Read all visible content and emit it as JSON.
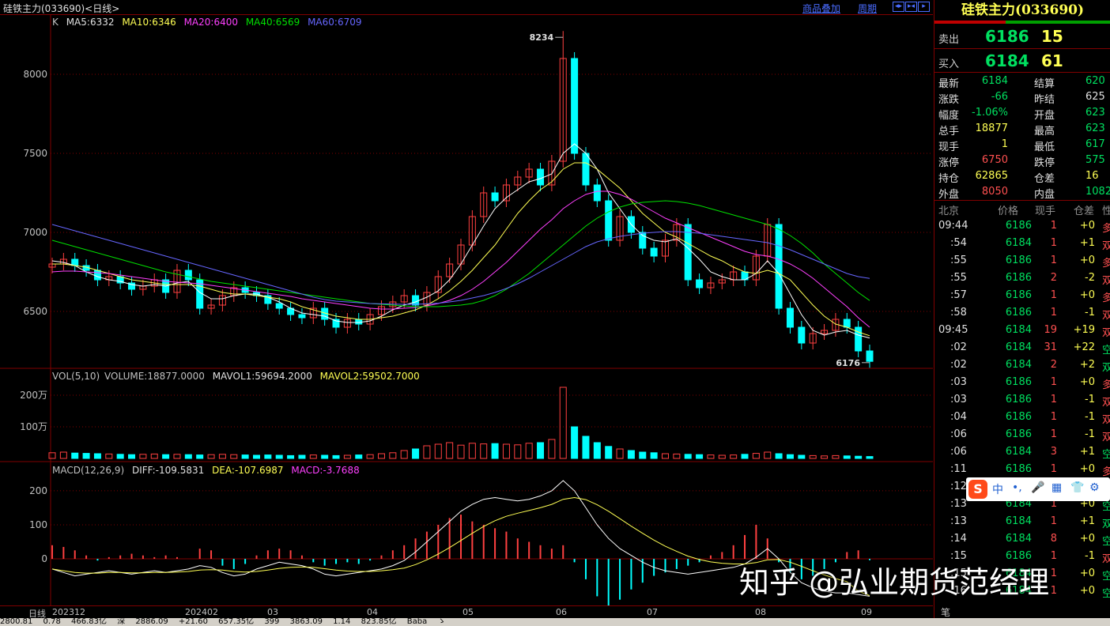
{
  "window": {
    "title": "硅铁主力(033690)<日线>",
    "links": [
      "商品叠加",
      "周期"
    ],
    "nav_buttons": [
      "◂▸",
      "▸◂",
      "▸"
    ]
  },
  "colors": {
    "up": "#ff4040",
    "down": "#00ffff",
    "ma5": "#ffffff",
    "ma10": "#ffff54",
    "ma20": "#ff40ff",
    "ma40": "#00e000",
    "ma60": "#6666ff",
    "grid": "#800000"
  },
  "price_legend": {
    "label": "K",
    "ma5": "MA5:6332",
    "ma10": "MA10:6346",
    "ma20": "MA20:6400",
    "ma40": "MA40:6569",
    "ma60": "MA60:6709"
  },
  "vol_legend": {
    "label": "VOL(5,10)",
    "volume": "VOLUME:18877.0000",
    "mavol1": "MAVOL1:59694.2000",
    "mavol2": "MAVOL2:59502.7000"
  },
  "macd_legend": {
    "label": "MACD(12,26,9)",
    "diff": "DIFF:-109.5831",
    "dea": "DEA:-107.6987",
    "macd": "MACD:-3.7688"
  },
  "chart_data": [
    {
      "type": "candlestick",
      "title": "",
      "ylim": [
        6180,
        8280
      ],
      "y_ticks": [
        "8000",
        "7500",
        "7000",
        "6500"
      ],
      "annotations": [
        {
          "label": "8234",
          "value": 8234
        },
        {
          "label": "6176",
          "value": 6176
        }
      ],
      "x_labels": [
        "202312",
        "202402",
        "03",
        "04",
        "05",
        "06",
        "07",
        "08",
        "09"
      ],
      "close_path": [
        6800,
        6830,
        6790,
        6760,
        6700,
        6720,
        6680,
        6640,
        6660,
        6700,
        6620,
        6760,
        6700,
        6520,
        6540,
        6600,
        6650,
        6620,
        6600,
        6550,
        6520,
        6480,
        6460,
        6520,
        6450,
        6400,
        6450,
        6420,
        6480,
        6530,
        6560,
        6600,
        6540,
        6620,
        6720,
        6800,
        6920,
        7100,
        7250,
        7200,
        7300,
        7350,
        7400,
        7300,
        7450,
        8100,
        7500,
        7300,
        7200,
        6950,
        7100,
        7000,
        6900,
        6850,
        6950,
        7050,
        6700,
        6650,
        6680,
        6700,
        6750,
        6700,
        6850,
        7050,
        6520,
        6400,
        6300,
        6360,
        6380,
        6450,
        6400,
        6250,
        6184
      ],
      "ma_series": [
        {
          "name": "MA5",
          "values": [
            6820,
            6810,
            6790,
            6750,
            6720,
            6700,
            6690,
            6670,
            6660,
            6670,
            6660,
            6680,
            6690,
            6620,
            6580,
            6580,
            6600,
            6610,
            6610,
            6590,
            6560,
            6520,
            6490,
            6480,
            6470,
            6440,
            6430,
            6430,
            6440,
            6470,
            6510,
            6540,
            6560,
            6590,
            6630,
            6700,
            6800,
            6920,
            7040,
            7150,
            7220,
            7270,
            7320,
            7340,
            7370,
            7500,
            7560,
            7500,
            7400,
            7250,
            7150,
            7050,
            6980,
            6950,
            6940,
            6960,
            6900,
            6830,
            6750,
            6720,
            6700,
            6700,
            6740,
            6820,
            6740,
            6610,
            6480,
            6380,
            6350,
            6370,
            6380,
            6350,
            6332
          ]
        },
        {
          "name": "MA10",
          "values": [
            6800,
            6800,
            6790,
            6780,
            6760,
            6740,
            6720,
            6700,
            6690,
            6680,
            6670,
            6670,
            6670,
            6660,
            6640,
            6620,
            6610,
            6610,
            6600,
            6590,
            6580,
            6560,
            6530,
            6510,
            6490,
            6470,
            6460,
            6450,
            6450,
            6460,
            6470,
            6490,
            6510,
            6540,
            6580,
            6630,
            6690,
            6760,
            6840,
            6920,
            7020,
            7120,
            7200,
            7270,
            7320,
            7400,
            7440,
            7440,
            7400,
            7340,
            7280,
            7200,
            7120,
            7060,
            7000,
            6970,
            6930,
            6890,
            6850,
            6820,
            6780,
            6750,
            6740,
            6760,
            6740,
            6700,
            6620,
            6540,
            6470,
            6420,
            6400,
            6370,
            6346
          ]
        },
        {
          "name": "MA20",
          "values": [
            6750,
            6755,
            6755,
            6750,
            6745,
            6740,
            6730,
            6720,
            6710,
            6700,
            6690,
            6685,
            6680,
            6675,
            6665,
            6655,
            6645,
            6635,
            6625,
            6615,
            6605,
            6595,
            6580,
            6570,
            6560,
            6550,
            6540,
            6530,
            6520,
            6515,
            6515,
            6520,
            6525,
            6535,
            6550,
            6570,
            6600,
            6640,
            6690,
            6750,
            6810,
            6880,
            6950,
            7020,
            7080,
            7150,
            7200,
            7240,
            7260,
            7260,
            7240,
            7210,
            7170,
            7130,
            7090,
            7060,
            7030,
            7000,
            6970,
            6940,
            6910,
            6880,
            6860,
            6850,
            6830,
            6800,
            6760,
            6710,
            6650,
            6590,
            6530,
            6460,
            6400
          ]
        },
        {
          "name": "MA40",
          "values": [
            6950,
            6930,
            6910,
            6890,
            6870,
            6850,
            6830,
            6810,
            6790,
            6770,
            6750,
            6735,
            6720,
            6705,
            6690,
            6680,
            6670,
            6660,
            6650,
            6640,
            6630,
            6620,
            6610,
            6600,
            6590,
            6580,
            6570,
            6560,
            6550,
            6545,
            6540,
            6535,
            6530,
            6530,
            6530,
            6535,
            6540,
            6550,
            6570,
            6600,
            6640,
            6690,
            6740,
            6800,
            6860,
            6920,
            6980,
            7040,
            7090,
            7130,
            7160,
            7180,
            7190,
            7195,
            7200,
            7195,
            7185,
            7170,
            7150,
            7130,
            7110,
            7090,
            7070,
            7050,
            7020,
            6980,
            6930,
            6870,
            6800,
            6740,
            6680,
            6620,
            6569
          ]
        },
        {
          "name": "MA60",
          "values": [
            7050,
            7030,
            7010,
            6990,
            6970,
            6950,
            6930,
            6910,
            6890,
            6870,
            6850,
            6830,
            6810,
            6790,
            6770,
            6750,
            6730,
            6710,
            6690,
            6670,
            6650,
            6630,
            6610,
            6590,
            6575,
            6565,
            6560,
            6555,
            6550,
            6548,
            6546,
            6545,
            6545,
            6548,
            6552,
            6560,
            6570,
            6585,
            6600,
            6620,
            6645,
            6675,
            6710,
            6750,
            6790,
            6830,
            6870,
            6910,
            6940,
            6960,
            6975,
            6985,
            6995,
            7000,
            7005,
            7005,
            7000,
            6995,
            6985,
            6975,
            6965,
            6955,
            6945,
            6935,
            6915,
            6890,
            6860,
            6830,
            6800,
            6770,
            6740,
            6720,
            6709
          ]
        }
      ]
    },
    {
      "type": "bar",
      "title": "",
      "y_ticks": [
        "200万",
        "100万"
      ],
      "ylim": [
        0,
        2300000
      ],
      "values": [
        180000,
        200000,
        170000,
        160000,
        150000,
        140000,
        130000,
        120000,
        130000,
        140000,
        120000,
        130000,
        120000,
        110000,
        120000,
        130000,
        120000,
        110000,
        100000,
        110000,
        100000,
        90000,
        100000,
        110000,
        100000,
        90000,
        100000,
        110000,
        120000,
        150000,
        180000,
        250000,
        300000,
        400000,
        450000,
        500000,
        420000,
        480000,
        460000,
        470000,
        450000,
        430000,
        480000,
        500000,
        600000,
        2250000,
        1000000,
        700000,
        500000,
        380000,
        300000,
        250000,
        200000,
        180000,
        150000,
        140000,
        130000,
        120000,
        110000,
        100000,
        110000,
        130000,
        160000,
        200000,
        150000,
        120000,
        100000,
        90000,
        80000,
        90000,
        80000,
        70000,
        60000
      ]
    },
    {
      "type": "bar",
      "title": "",
      "y_ticks": [
        "200",
        "100",
        "0"
      ],
      "ylim": [
        -130,
        230
      ],
      "values": [
        40,
        35,
        25,
        10,
        -5,
        5,
        10,
        15,
        10,
        5,
        10,
        5,
        0,
        30,
        25,
        -20,
        -30,
        -15,
        10,
        25,
        30,
        25,
        10,
        -10,
        -20,
        -15,
        -10,
        -15,
        -5,
        10,
        25,
        40,
        60,
        80,
        100,
        120,
        130,
        110,
        100,
        90,
        80,
        60,
        50,
        40,
        30,
        40,
        -10,
        -60,
        -110,
        -140,
        -120,
        -90,
        -70,
        -50,
        -40,
        -30,
        -20,
        -10,
        10,
        20,
        40,
        70,
        100,
        60,
        -10,
        -40,
        -60,
        -50,
        -30,
        -10,
        20,
        25,
        -4
      ],
      "diff": [
        -30,
        -40,
        -50,
        -45,
        -40,
        -35,
        -40,
        -45,
        -40,
        -35,
        -40,
        -35,
        -30,
        -20,
        -25,
        -40,
        -50,
        -45,
        -30,
        -20,
        -10,
        -15,
        -20,
        -30,
        -45,
        -50,
        -45,
        -40,
        -35,
        -30,
        -20,
        -5,
        20,
        50,
        80,
        110,
        140,
        160,
        175,
        180,
        175,
        170,
        175,
        185,
        200,
        230,
        200,
        150,
        100,
        60,
        30,
        10,
        -10,
        -25,
        -35,
        -40,
        -45,
        -40,
        -35,
        -30,
        -25,
        -15,
        5,
        30,
        0,
        -40,
        -70,
        -85,
        -95,
        -100,
        -100,
        -105,
        -110
      ],
      "dea": [
        -30,
        -35,
        -40,
        -42,
        -42,
        -40,
        -40,
        -41,
        -41,
        -40,
        -40,
        -39,
        -37,
        -33,
        -32,
        -33,
        -37,
        -39,
        -37,
        -33,
        -28,
        -25,
        -24,
        -25,
        -29,
        -33,
        -36,
        -37,
        -37,
        -35,
        -32,
        -27,
        -17,
        -3,
        14,
        33,
        54,
        75,
        95,
        112,
        125,
        134,
        142,
        150,
        160,
        175,
        180,
        174,
        159,
        140,
        118,
        96,
        75,
        55,
        37,
        22,
        8,
        -2,
        -9,
        -13,
        -15,
        -15,
        -11,
        -3,
        -2,
        -10,
        -22,
        -35,
        -47,
        -58,
        -67,
        -95,
        -108
      ]
    }
  ],
  "panel": {
    "title": "硅铁主力(033690)",
    "sell": {
      "label": "卖出",
      "price": "6186",
      "vol": "15"
    },
    "buy": {
      "label": "买入",
      "price": "6184",
      "vol": "61"
    },
    "stats": [
      {
        "l1": "最新",
        "v1": "6184",
        "c1": "green",
        "l2": "结算",
        "v2": "620",
        "c2": "green"
      },
      {
        "l1": "涨跌",
        "v1": "-66",
        "c1": "green",
        "l2": "昨结",
        "v2": "625",
        "c2": "white"
      },
      {
        "l1": "幅度",
        "v1": "-1.06%",
        "c1": "green",
        "l2": "开盘",
        "v2": "623",
        "c2": "green"
      },
      {
        "l1": "总手",
        "v1": "18877",
        "c1": "yellow",
        "l2": "最高",
        "v2": "623",
        "c2": "green"
      },
      {
        "l1": "现手",
        "v1": "1",
        "c1": "yellow",
        "l2": "最低",
        "v2": "617",
        "c2": "green"
      },
      {
        "l1": "涨停",
        "v1": "6750",
        "c1": "red",
        "l2": "跌停",
        "v2": "575",
        "c2": "green"
      },
      {
        "l1": "持仓",
        "v1": "62865",
        "c1": "yellow",
        "l2": "仓差",
        "v2": "16",
        "c2": "yellow"
      },
      {
        "l1": "外盘",
        "v1": "8050",
        "c1": "red",
        "l2": "内盘",
        "v2": "1082",
        "c2": "green"
      }
    ],
    "tick_header": [
      "北京",
      "价格",
      "现手",
      "仓差",
      "性"
    ],
    "ticks": [
      {
        "t": "09:44",
        "p": "6186",
        "pc": "green",
        "v": "1",
        "d": "+0",
        "n": "多",
        "nc": "red"
      },
      {
        "t": ":54",
        "p": "6184",
        "pc": "green",
        "v": "1",
        "d": "+1",
        "n": "双",
        "nc": "red"
      },
      {
        "t": ":55",
        "p": "6186",
        "pc": "green",
        "v": "1",
        "d": "+0",
        "n": "多",
        "nc": "red"
      },
      {
        "t": ":55",
        "p": "6186",
        "pc": "green",
        "v": "2",
        "d": "-2",
        "n": "双",
        "nc": "red"
      },
      {
        "t": ":57",
        "p": "6186",
        "pc": "green",
        "v": "1",
        "d": "+0",
        "n": "多",
        "nc": "red"
      },
      {
        "t": ":58",
        "p": "6186",
        "pc": "green",
        "v": "1",
        "d": "-1",
        "n": "双",
        "nc": "red"
      },
      {
        "t": "09:45",
        "p": "6184",
        "pc": "green",
        "v": "19",
        "d": "+19",
        "n": "双",
        "nc": "red"
      },
      {
        "t": ":02",
        "p": "6184",
        "pc": "green",
        "v": "31",
        "d": "+22",
        "n": "空",
        "nc": "green"
      },
      {
        "t": ":02",
        "p": "6184",
        "pc": "green",
        "v": "2",
        "d": "+2",
        "n": "双",
        "nc": "green"
      },
      {
        "t": ":03",
        "p": "6186",
        "pc": "green",
        "v": "1",
        "d": "+0",
        "n": "多",
        "nc": "red"
      },
      {
        "t": ":03",
        "p": "6186",
        "pc": "green",
        "v": "1",
        "d": "-1",
        "n": "双",
        "nc": "red"
      },
      {
        "t": ":04",
        "p": "6186",
        "pc": "green",
        "v": "1",
        "d": "-1",
        "n": "双",
        "nc": "red"
      },
      {
        "t": ":06",
        "p": "6186",
        "pc": "green",
        "v": "1",
        "d": "-1",
        "n": "双",
        "nc": "red"
      },
      {
        "t": ":06",
        "p": "6184",
        "pc": "green",
        "v": "3",
        "d": "+1",
        "n": "空",
        "nc": "green"
      },
      {
        "t": ":11",
        "p": "6186",
        "pc": "green",
        "v": "1",
        "d": "+0",
        "n": "多",
        "nc": "red"
      },
      {
        "t": ":12",
        "p": "6184",
        "pc": "green",
        "v": "1",
        "d": "+0",
        "n": "空",
        "nc": "green"
      },
      {
        "t": ":13",
        "p": "6184",
        "pc": "green",
        "v": "1",
        "d": "+0",
        "n": "空",
        "nc": "green"
      },
      {
        "t": ":13",
        "p": "6184",
        "pc": "green",
        "v": "1",
        "d": "+1",
        "n": "双",
        "nc": "green"
      },
      {
        "t": ":14",
        "p": "6184",
        "pc": "green",
        "v": "8",
        "d": "+0",
        "n": "空",
        "nc": "green"
      },
      {
        "t": ":15",
        "p": "6186",
        "pc": "green",
        "v": "1",
        "d": "-1",
        "n": "双",
        "nc": "red"
      },
      {
        "t": ":15",
        "p": "6184",
        "pc": "green",
        "v": "1",
        "d": "+0",
        "n": "空",
        "nc": "green"
      },
      {
        "t": ":16",
        "p": "6184",
        "pc": "green",
        "v": "1",
        "d": "+0",
        "n": "空",
        "nc": "green"
      }
    ],
    "bottom_tab": "笔"
  },
  "xaxis_label": "日线",
  "ime": {
    "lang": "中",
    "glyphs": [
      "•,",
      "🎤",
      "▦",
      "👕",
      "⚙"
    ]
  },
  "watermark": "知乎 @弘业期货范经理",
  "statusbar": [
    "2800.81",
    "0.78",
    "466.83亿",
    "深",
    "2886.09",
    "+21.60",
    "657.35亿",
    "399",
    "3863.09",
    "1.14",
    "823.85亿",
    "Baba",
    "ゝ"
  ]
}
